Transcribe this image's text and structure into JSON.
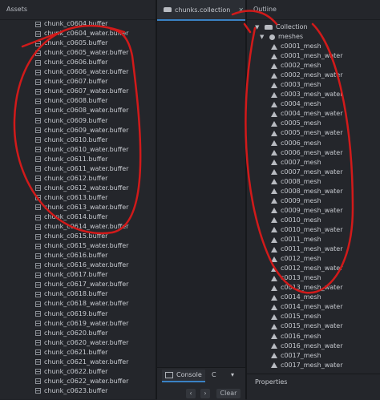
{
  "assets": {
    "title": "Assets",
    "files": [
      "chunk_c0604.buffer",
      "chunk_c0604_water.buffer",
      "chunk_c0605.buffer",
      "chunk_c0605_water.buffer",
      "chunk_c0606.buffer",
      "chunk_c0606_water.buffer",
      "chunk_c0607.buffer",
      "chunk_c0607_water.buffer",
      "chunk_c0608.buffer",
      "chunk_c0608_water.buffer",
      "chunk_c0609.buffer",
      "chunk_c0609_water.buffer",
      "chunk_c0610.buffer",
      "chunk_c0610_water.buffer",
      "chunk_c0611.buffer",
      "chunk_c0611_water.buffer",
      "chunk_c0612.buffer",
      "chunk_c0612_water.buffer",
      "chunk_c0613.buffer",
      "chunk_c0613_water.buffer",
      "chunk_c0614.buffer",
      "chunk_c0614_water.buffer",
      "chunk_c0615.buffer",
      "chunk_c0615_water.buffer",
      "chunk_c0616.buffer",
      "chunk_c0616_water.buffer",
      "chunk_c0617.buffer",
      "chunk_c0617_water.buffer",
      "chunk_c0618.buffer",
      "chunk_c0618_water.buffer",
      "chunk_c0619.buffer",
      "chunk_c0619_water.buffer",
      "chunk_c0620.buffer",
      "chunk_c0620_water.buffer",
      "chunk_c0621.buffer",
      "chunk_c0621_water.buffer",
      "chunk_c0622.buffer",
      "chunk_c0622_water.buffer",
      "chunk_c0623.buffer"
    ]
  },
  "editor": {
    "tab_label": "chunks.collection",
    "close_glyph": "✕"
  },
  "console": {
    "tab_label": "Console",
    "other_tab": "C",
    "clear_label": "Clear",
    "prev_glyph": "‹",
    "next_glyph": "›"
  },
  "outline": {
    "title": "Outline",
    "root": "Collection",
    "group": "meshes",
    "items": [
      "c0001_mesh",
      "c0001_mesh_water",
      "c0002_mesh",
      "c0002_mesh_water",
      "c0003_mesh",
      "c0003_mesh_water",
      "c0004_mesh",
      "c0004_mesh_water",
      "c0005_mesh",
      "c0005_mesh_water",
      "c0006_mesh",
      "c0006_mesh_water",
      "c0007_mesh",
      "c0007_mesh_water",
      "c0008_mesh",
      "c0008_mesh_water",
      "c0009_mesh",
      "c0009_mesh_water",
      "c0010_mesh",
      "c0010_mesh_water",
      "c0011_mesh",
      "c0011_mesh_water",
      "c0012_mesh",
      "c0012_mesh_water",
      "c0013_mesh",
      "c0013_mesh_water",
      "c0014_mesh",
      "c0014_mesh_water",
      "c0015_mesh",
      "c0015_mesh_water",
      "c0016_mesh",
      "c0016_mesh_water",
      "c0017_mesh",
      "c0017_mesh_water"
    ]
  },
  "properties": {
    "title": "Properties"
  },
  "colors": {
    "annotation": "#d11a1a",
    "accent": "#3a82c4"
  },
  "icons": {
    "file": "file-icon",
    "mesh": "mesh-icon",
    "collection": "collection-icon",
    "gameobject": "gameobject-icon"
  }
}
